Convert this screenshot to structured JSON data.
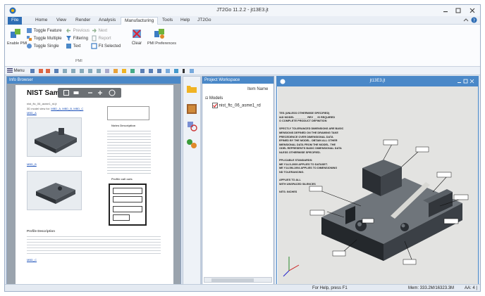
{
  "window": {
    "title": "JT2Go 11.2.2 - jt13E3.jt"
  },
  "ribbon_tabs": [
    {
      "label": "File"
    },
    {
      "label": "Home"
    },
    {
      "label": "View"
    },
    {
      "label": "Render"
    },
    {
      "label": "Analysis"
    },
    {
      "label": "Manufacturing"
    },
    {
      "label": "Tools"
    },
    {
      "label": "Help"
    },
    {
      "label": "JT2Go"
    }
  ],
  "ribbon": {
    "enable_pmi": "Enable PMI",
    "toggle_feature": "Toggle Feature",
    "toggle_multiple": "Toggle Multiple",
    "toggle_single": "Toggle Single",
    "previous": "Previous",
    "next": "Next",
    "filtering": "Filtering",
    "report": "Report",
    "text": "Text",
    "fit_selected": "Fit Selected",
    "clear": "Clear",
    "pmi_preferences": "PMI Preferences",
    "group_label": "PMI"
  },
  "qat": {
    "menu_label": "Menu"
  },
  "info_browser": {
    "header": "Info Browser",
    "doc_title": "NIST Sam",
    "subtitle": "nist_ftc_06_asme1_rd.jt",
    "model_view_label": "3D model view for:",
    "model_view_links": "MBD_A, MBD_B, MBD_C",
    "link_a": "MBD_A",
    "link_b": "MBD_B",
    "notes_title": "Notes Description",
    "profile_callouts": "Profile call outs",
    "profile_desc_title": "Profile Description",
    "link_bottom": "MBD_C"
  },
  "project_workspace": {
    "header": "Project Workspace",
    "column_item_name": "Item Name",
    "models_label": "Models",
    "model_item": "nist_ftc_06_asme1_rd"
  },
  "viewport": {
    "title": "jt13E3.jt",
    "notes": [
      "TES (UNLESS OTHERWISE SPECIFIED)",
      "IAD MODEL ________ REV __ IS REQUIRED",
      "O COMPLETE PRODUCT DEFINITION",
      "",
      "SPECTLY TOLERANCED DIMENSIONS ARE BASIC",
      "MENSIONS DEFINED ON THE DRAWING TAKE",
      "PRECEDENCE OVER DIMENSIONAL DATA",
      "EFINED BY THE MODEL. OBTAIN ALL OTHER",
      "IMENSIONAL DATA FROM THE MODEL. THE",
      "ODEL REPRESENTS BASIC DIMENSIONAL DATA",
      "NLESS OTHERWISE SPECIFIED.",
      "",
      "PPLICABLE STANDARDS:",
      "ME Y14.5-2009 APPLIES TO DATASET.",
      "ME Y14.5M-1994 APPLIES TO DIMENSIONING",
      "ND TOLERANCING.",
      "",
      "     APPLIES TO ALL",
      "WITH UNSPACED SILENCES",
      "",
      "NITS: INCHES"
    ]
  },
  "statusbar": {
    "help": "For Help, press F1",
    "memory": "Mem: 333.2M/16323.3M",
    "aa": "AA: 4 |"
  },
  "colors": {
    "accent": "#2e6db4",
    "panel_header": "#4a88c8",
    "part_dark": "#2f3338",
    "part_top": "#6d7278"
  }
}
